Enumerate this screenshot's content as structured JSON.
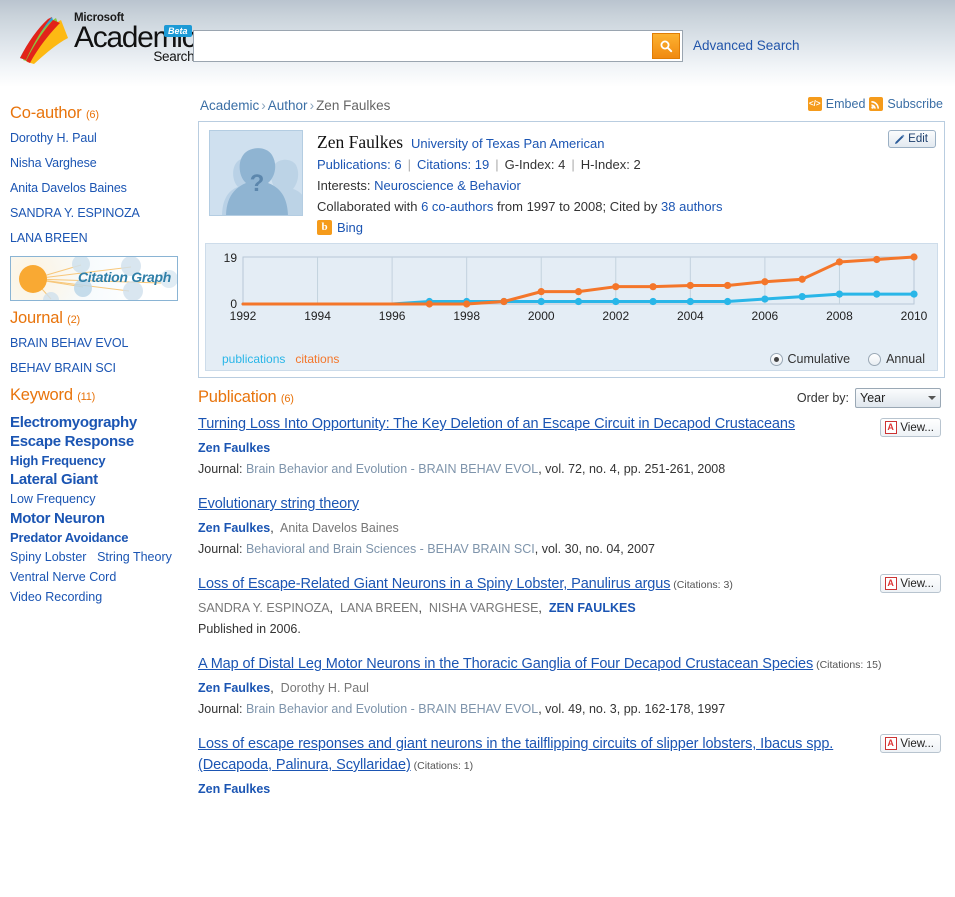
{
  "header": {
    "brand_microsoft": "Microsoft",
    "brand_academic": "Academic",
    "brand_search": "Search",
    "beta_badge": "Beta",
    "search_value": "",
    "search_placeholder": "",
    "advanced_search": "Advanced Search",
    "accent_orange": "#f08a11",
    "accent_blue": "#1b55b3"
  },
  "sidebar": {
    "coauthor": {
      "heading": "Co-author",
      "count": "(6)",
      "items": [
        "Dorothy H. Paul",
        "Nisha Varghese",
        "Anita Davelos Baines",
        "SANDRA Y. ESPINOZA",
        "LANA BREEN"
      ]
    },
    "citation_graph_label": "Citation Graph",
    "journal": {
      "heading": "Journal",
      "count": "(2)",
      "items": [
        "BRAIN BEHAV EVOL",
        "BEHAV BRAIN SCI"
      ]
    },
    "keyword": {
      "heading": "Keyword",
      "count": "(11)",
      "items": [
        {
          "label": "Electromyography",
          "size": "s1"
        },
        {
          "label": "Escape Response",
          "size": "s1"
        },
        {
          "label": "High Frequency",
          "size": "s2"
        },
        {
          "label": "Lateral Giant",
          "size": "s1"
        },
        {
          "label": "Low Frequency",
          "size": "s3"
        },
        {
          "label": "Motor Neuron",
          "size": "s1"
        },
        {
          "label": "Predator Avoidance",
          "size": "s2"
        },
        {
          "label": "Spiny Lobster",
          "size": "s3"
        },
        {
          "label": "String Theory",
          "size": "s3"
        },
        {
          "label": "Ventral Nerve Cord",
          "size": "s3"
        },
        {
          "label": "Video Recording",
          "size": "s3"
        }
      ]
    }
  },
  "main": {
    "breadcrumb": {
      "academic": "Academic",
      "author": "Author",
      "current": "Zen Faulkes",
      "separator": "›"
    },
    "embed_label": "Embed",
    "subscribe_label": "Subscribe",
    "embed_glyph": "</>",
    "subscribe_glyph": "⌁",
    "profile": {
      "name": "Zen Faulkes",
      "affiliation": "University of Texas Pan American",
      "publications_label": "Publications: 6",
      "citations_label": "Citations: 19",
      "gindex_label": "G-Index: 4",
      "hindex_label": "H-Index: 2",
      "interests_prefix": "Interests:",
      "interests_value": "Neuroscience & Behavior",
      "collab_prefix": "Collaborated with",
      "collab_coauthors": "6 co-authors",
      "collab_mid": "from 1997 to 2008; Cited by",
      "collab_cited": "38 authors",
      "bing_label": "Bing",
      "bing_glyph": "b",
      "edit_label": "Edit",
      "avatar_glyph": "?"
    },
    "chart_controls": {
      "legend_publications": "publications",
      "legend_citations": "citations",
      "cumulative_label": "Cumulative",
      "annual_label": "Annual",
      "selected_mode": "Cumulative"
    },
    "publications_heading": "Publication",
    "publications_count": "(6)",
    "orderby_label": "Order by:",
    "orderby_value": "Year",
    "orderby_options": [
      "Year"
    ],
    "view_label": "View...",
    "publications": [
      {
        "title": "Turning Loss Into Opportunity: The Key Deletion of an Escape Circuit in Decapod Crustaceans",
        "citations": "",
        "authors": [
          {
            "name": "Zen Faulkes",
            "self": true
          }
        ],
        "journal_prefix": "Journal:",
        "journal_name": "Brain Behavior and Evolution - BRAIN BEHAV EVOL",
        "journal_detail": ", vol. 72, no. 4, pp. 251-261, 2008",
        "has_view": true,
        "published_note": ""
      },
      {
        "title": "Evolutionary string theory",
        "citations": "",
        "authors": [
          {
            "name": "Zen Faulkes",
            "self": true
          },
          {
            "name": "Anita Davelos Baines",
            "self": false
          }
        ],
        "journal_prefix": "Journal:",
        "journal_name": "Behavioral and Brain Sciences - BEHAV BRAIN SCI",
        "journal_detail": ", vol. 30, no. 04, 2007",
        "has_view": false,
        "published_note": ""
      },
      {
        "title": "Loss of Escape-Related Giant Neurons in a Spiny Lobster, Panulirus argus",
        "citations": "(Citations: 3)",
        "authors": [
          {
            "name": "SANDRA Y. ESPINOZA",
            "self": false
          },
          {
            "name": "LANA BREEN",
            "self": false
          },
          {
            "name": "NISHA VARGHESE",
            "self": false
          },
          {
            "name": "ZEN FAULKES",
            "self": true
          }
        ],
        "journal_prefix": "",
        "journal_name": "",
        "journal_detail": "",
        "has_view": true,
        "published_note": "Published in 2006."
      },
      {
        "title": "A Map of Distal Leg Motor Neurons in the Thoracic Ganglia of Four Decapod Crustacean Species",
        "citations": "(Citations: 15)",
        "authors": [
          {
            "name": "Zen Faulkes",
            "self": true
          },
          {
            "name": "Dorothy H. Paul",
            "self": false
          }
        ],
        "journal_prefix": "Journal:",
        "journal_name": "Brain Behavior and Evolution - BRAIN BEHAV EVOL",
        "journal_detail": ", vol. 49, no. 3, pp. 162-178, 1997",
        "has_view": false,
        "published_note": ""
      },
      {
        "title": "Loss of escape responses and giant neurons in the tailflipping circuits of slipper lobsters, Ibacus spp. (Decapoda, Palinura, Scyllaridae)",
        "citations": "(Citations: 1)",
        "authors": [
          {
            "name": "Zen Faulkes",
            "self": true
          }
        ],
        "journal_prefix": "",
        "journal_name": "",
        "journal_detail": "",
        "has_view": true,
        "published_note": ""
      }
    ]
  },
  "chart_data": {
    "type": "line",
    "title": "",
    "xlabel": "",
    "ylabel": "",
    "ylim": [
      0,
      19
    ],
    "ytick_labels": [
      "0",
      "19"
    ],
    "grid": true,
    "legend_position": "bottom-left",
    "x": [
      1992,
      1993,
      1994,
      1995,
      1996,
      1997,
      1998,
      1999,
      2000,
      2001,
      2002,
      2003,
      2004,
      2005,
      2006,
      2007,
      2008,
      2009,
      2010
    ],
    "xtick_labels": [
      "1992",
      "1994",
      "1996",
      "1998",
      "2000",
      "2002",
      "2004",
      "2006",
      "2008",
      "2010"
    ],
    "series": [
      {
        "name": "publications",
        "color": "#29b6e8",
        "values": [
          0,
          0,
          0,
          0,
          0,
          1,
          1,
          1,
          1,
          1,
          1,
          1,
          1,
          1,
          2,
          3,
          4,
          4,
          4
        ]
      },
      {
        "name": "citations",
        "color": "#f4762a",
        "values": [
          0,
          0,
          0,
          0,
          0,
          0,
          0,
          1,
          5,
          5,
          7,
          7,
          7.5,
          7.5,
          9,
          10,
          17,
          18,
          19
        ]
      }
    ]
  }
}
